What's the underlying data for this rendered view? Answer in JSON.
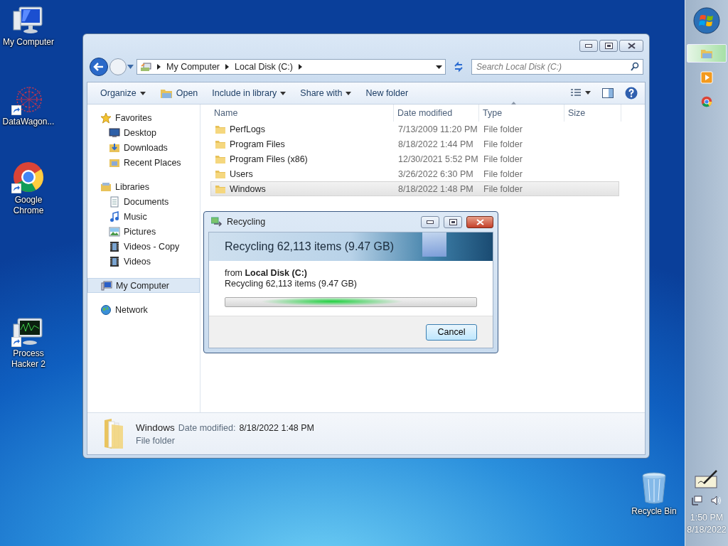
{
  "desktop_icons": [
    {
      "label": "My Computer",
      "kind": "computer",
      "shortcut": false
    },
    {
      "label": "DataWagon...",
      "kind": "network-art",
      "shortcut": true
    },
    {
      "label": "Google Chrome",
      "kind": "browser",
      "shortcut": true
    },
    {
      "label": "Process Hacker 2",
      "kind": "monitor-app",
      "shortcut": true
    },
    {
      "label": "Recycle Bin",
      "kind": "bin",
      "shortcut": false
    }
  ],
  "explorer": {
    "address_bar": {
      "crumbs": [
        "My Computer",
        "Local Disk (C:)"
      ]
    },
    "search": {
      "placeholder": "Search Local Disk (C:)"
    },
    "toolbar": [
      {
        "label": "Organize",
        "kind": "menu"
      },
      {
        "label": "Open",
        "kind": "open"
      },
      {
        "label": "Include in library",
        "kind": "menu"
      },
      {
        "label": "Share with",
        "kind": "menu"
      },
      {
        "label": "New folder",
        "kind": "plain"
      }
    ],
    "navigation": [
      {
        "label": "Favorites",
        "kind": "star",
        "selected": false,
        "children": [
          {
            "label": "Desktop",
            "kind": "desktop",
            "selected": false
          },
          {
            "label": "Downloads",
            "kind": "downloads",
            "selected": false
          },
          {
            "label": "Recent Places",
            "kind": "recent",
            "selected": false
          }
        ]
      },
      {
        "label": "Libraries",
        "kind": "library",
        "selected": false,
        "children": [
          {
            "label": "Documents",
            "kind": "documents",
            "selected": false
          },
          {
            "label": "Music",
            "kind": "music",
            "selected": false
          },
          {
            "label": "Pictures",
            "kind": "pictures",
            "selected": false
          },
          {
            "label": "Videos - Copy",
            "kind": "videos",
            "selected": false
          },
          {
            "label": "Videos",
            "kind": "videos",
            "selected": false
          }
        ]
      },
      {
        "label": "My Computer",
        "kind": "computer",
        "selected": true
      },
      {
        "label": "Network",
        "kind": "network",
        "selected": false
      }
    ],
    "table": {
      "columns": [
        "Name",
        "Date modified",
        "Type",
        "Size"
      ],
      "rows": [
        {
          "name": "PerfLogs",
          "date_modified": "7/13/2009 11:20 PM",
          "type": "File folder",
          "selected": false
        },
        {
          "name": "Program Files",
          "date_modified": "8/18/2022 1:44 PM",
          "type": "File folder",
          "selected": false
        },
        {
          "name": "Program Files (x86)",
          "date_modified": "12/30/2021 5:52 PM",
          "type": "File folder",
          "selected": false
        },
        {
          "name": "Users",
          "date_modified": "3/26/2022 6:30 PM",
          "type": "File folder",
          "selected": false
        },
        {
          "name": "Windows",
          "date_modified": "8/18/2022 1:48 PM",
          "type": "File folder",
          "selected": true
        }
      ]
    },
    "details_pane": {
      "name": "Windows",
      "date_label": "Date modified:",
      "date_value": "8/18/2022 1:48 PM",
      "type": "File folder"
    }
  },
  "dialog": {
    "title": "Recycling",
    "header": "Recycling 62,113 items (9.47 GB)",
    "source": "from **Local Disk (C:)**",
    "status": "Recycling 62,113 items (9.47 GB)",
    "progress": {
      "indeterminate": true
    },
    "buttons": [
      "Cancel"
    ]
  },
  "taskbar": {
    "apps": [
      {
        "kind": "explorer",
        "selected": true
      },
      {
        "kind": "media",
        "selected": false
      },
      {
        "kind": "browser",
        "selected": false
      }
    ],
    "clock": {
      "time": "1:50 PM",
      "date": "8/18/2022"
    }
  }
}
